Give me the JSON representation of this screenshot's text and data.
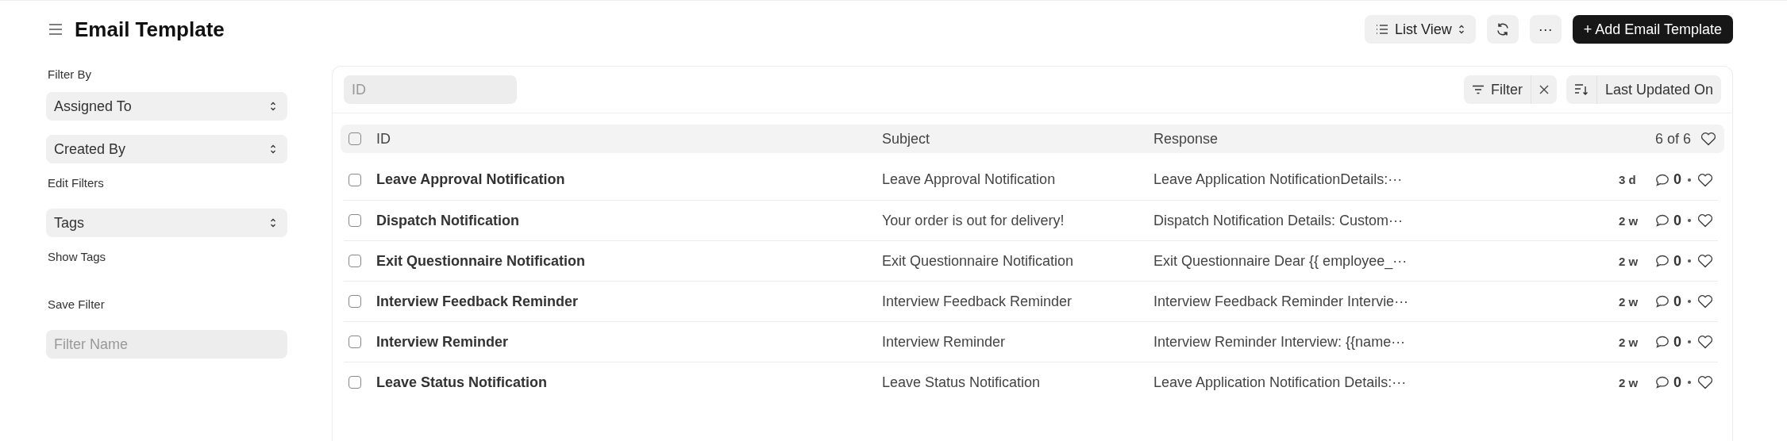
{
  "page": {
    "title": "Email Template"
  },
  "toolbar": {
    "view_switcher": "List View",
    "more": "···",
    "add_button": "+ Add Email Template"
  },
  "sidebar": {
    "filter_by_label": "Filter By",
    "filters": [
      {
        "label": "Assigned To"
      },
      {
        "label": "Created By"
      }
    ],
    "edit_filters": "Edit Filters",
    "tags": {
      "label": "Tags"
    },
    "show_tags": "Show Tags",
    "save_filter_label": "Save Filter",
    "filter_name": {
      "placeholder": "Filter Name"
    }
  },
  "list": {
    "search": {
      "placeholder": "ID"
    },
    "filter_button": "Filter",
    "sort_button": "Last Updated On",
    "header": {
      "checked": false,
      "columns": [
        "ID",
        "Subject",
        "Response"
      ],
      "count": "6 of 6"
    },
    "rows": [
      {
        "checked": false,
        "id": "Leave Approval Notification",
        "subject": "Leave Approval Notification",
        "response": "Leave Application NotificationDetails:···",
        "age": "3 d",
        "comments": "0"
      },
      {
        "checked": false,
        "id": "Dispatch Notification",
        "subject": "Your order is out for delivery!",
        "response": "Dispatch Notification Details: Custom···",
        "age": "2 w",
        "comments": "0"
      },
      {
        "checked": false,
        "id": "Exit Questionnaire Notification",
        "subject": "Exit Questionnaire Notification",
        "response": "Exit Questionnaire Dear {{ employee_···",
        "age": "2 w",
        "comments": "0"
      },
      {
        "checked": false,
        "id": "Interview Feedback Reminder",
        "subject": "Interview Feedback Reminder",
        "response": "Interview Feedback Reminder Intervie···",
        "age": "2 w",
        "comments": "0"
      },
      {
        "checked": false,
        "id": "Interview Reminder",
        "subject": "Interview Reminder",
        "response": "Interview Reminder Interview: {{name···",
        "age": "2 w",
        "comments": "0"
      },
      {
        "checked": false,
        "id": "Leave Status Notification",
        "subject": "Leave Status Notification",
        "response": "Leave Application Notification Details:···",
        "age": "2 w",
        "comments": "0"
      }
    ]
  }
}
